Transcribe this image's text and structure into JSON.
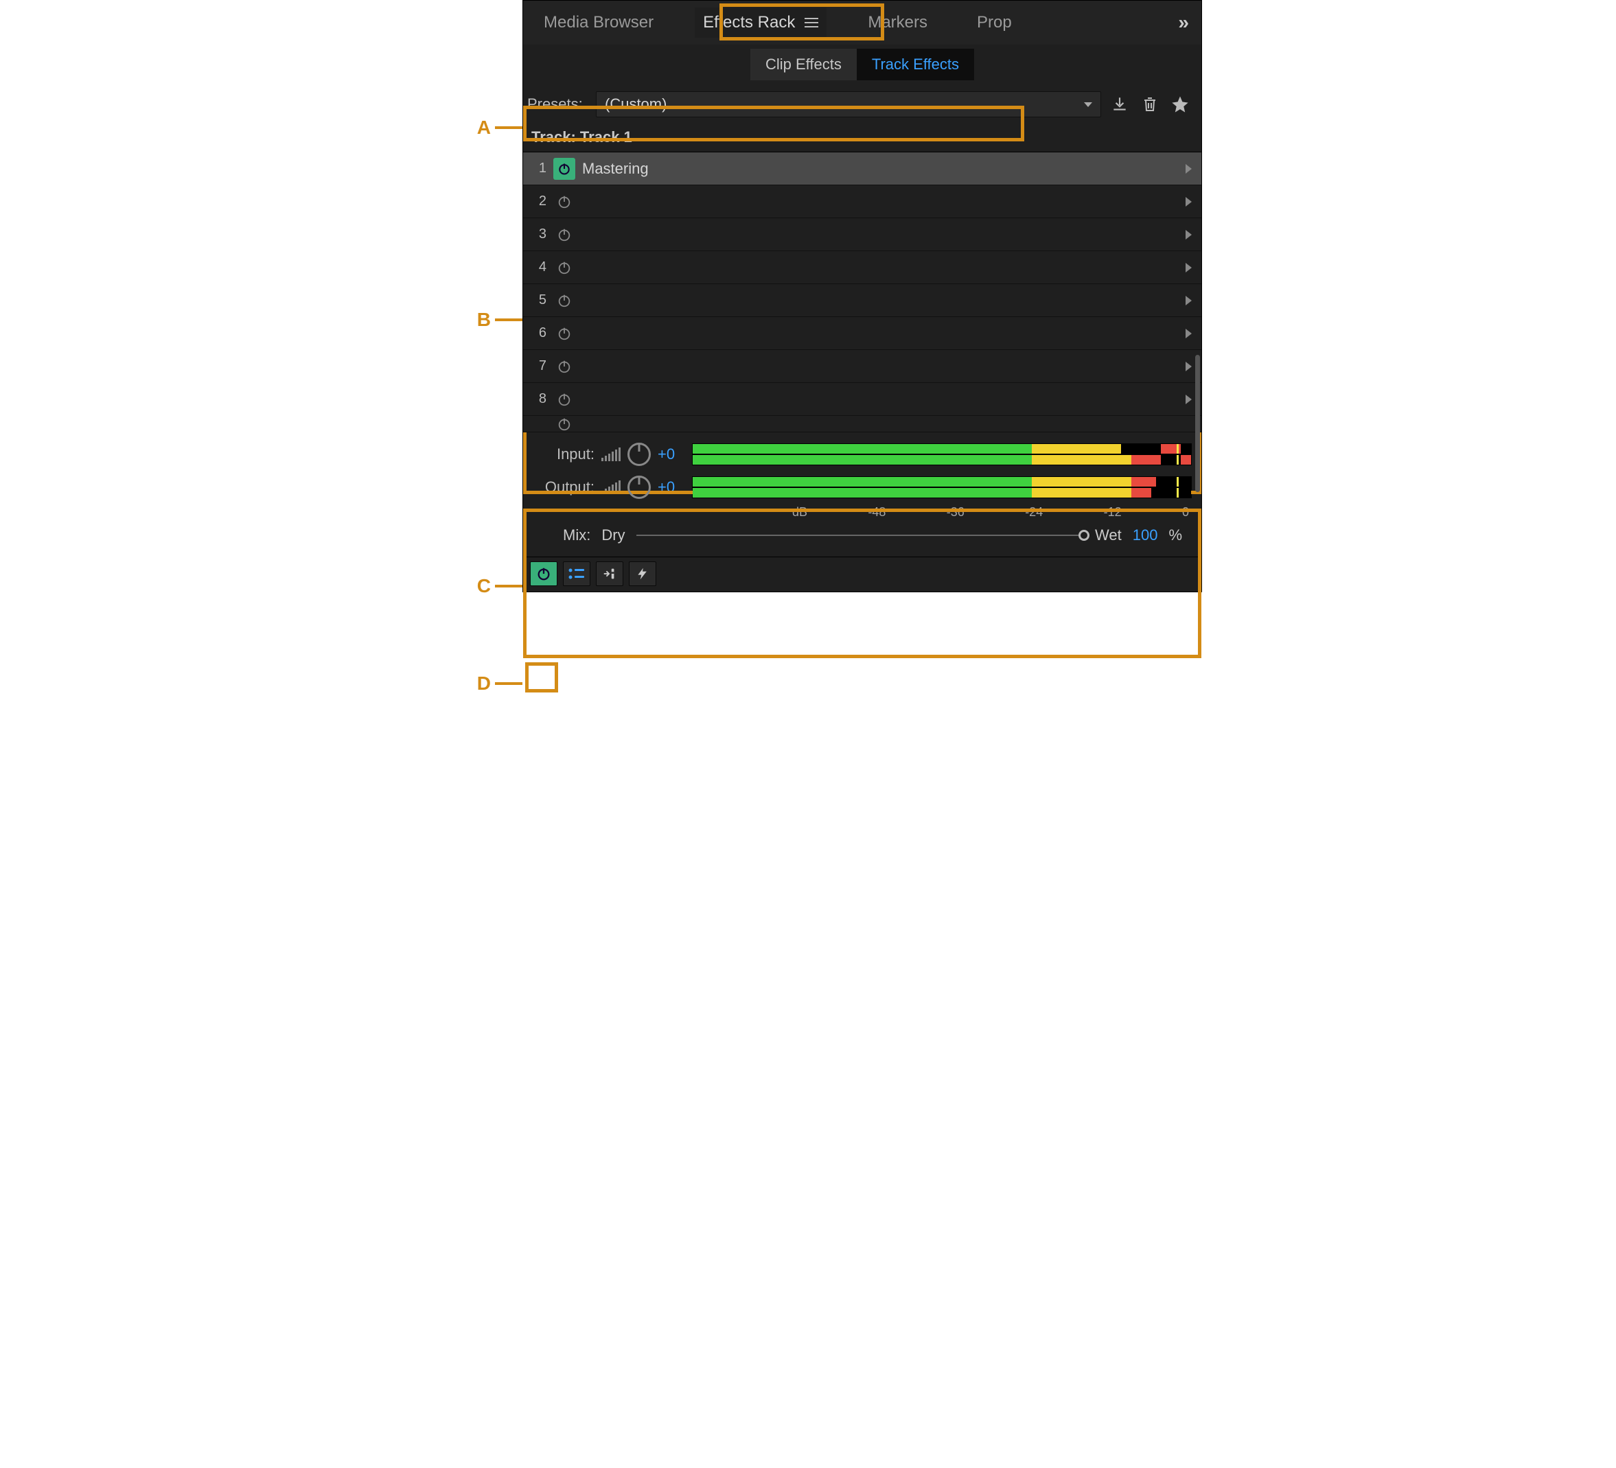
{
  "labels": {
    "a": "A",
    "b": "B",
    "c": "C",
    "d": "D"
  },
  "tabs": {
    "media": "Media Browser",
    "effects": "Effects Rack",
    "markers": "Markers",
    "prop": "Prop",
    "overflow": "»"
  },
  "subtabs": {
    "clip": "Clip Effects",
    "track": "Track Effects"
  },
  "presets": {
    "label": "Presets:",
    "value": "(Custom)"
  },
  "track_label": "Track: Track 1",
  "slots": [
    {
      "num": "1",
      "name": "Mastering",
      "on": true,
      "selected": true
    },
    {
      "num": "2",
      "name": "",
      "on": false,
      "selected": false
    },
    {
      "num": "3",
      "name": "",
      "on": false,
      "selected": false
    },
    {
      "num": "4",
      "name": "",
      "on": false,
      "selected": false
    },
    {
      "num": "5",
      "name": "",
      "on": false,
      "selected": false
    },
    {
      "num": "6",
      "name": "",
      "on": false,
      "selected": false
    },
    {
      "num": "7",
      "name": "",
      "on": false,
      "selected": false
    },
    {
      "num": "8",
      "name": "",
      "on": false,
      "selected": false
    }
  ],
  "io": {
    "input_label": "Input:",
    "input_value": "+0",
    "output_label": "Output:",
    "output_value": "+0"
  },
  "db_scale": [
    "dB",
    "-48",
    "-36",
    "-24",
    "-12",
    "0"
  ],
  "mix": {
    "label": "Mix:",
    "dry": "Dry",
    "wet": "Wet",
    "value": "100",
    "pct": "%"
  }
}
